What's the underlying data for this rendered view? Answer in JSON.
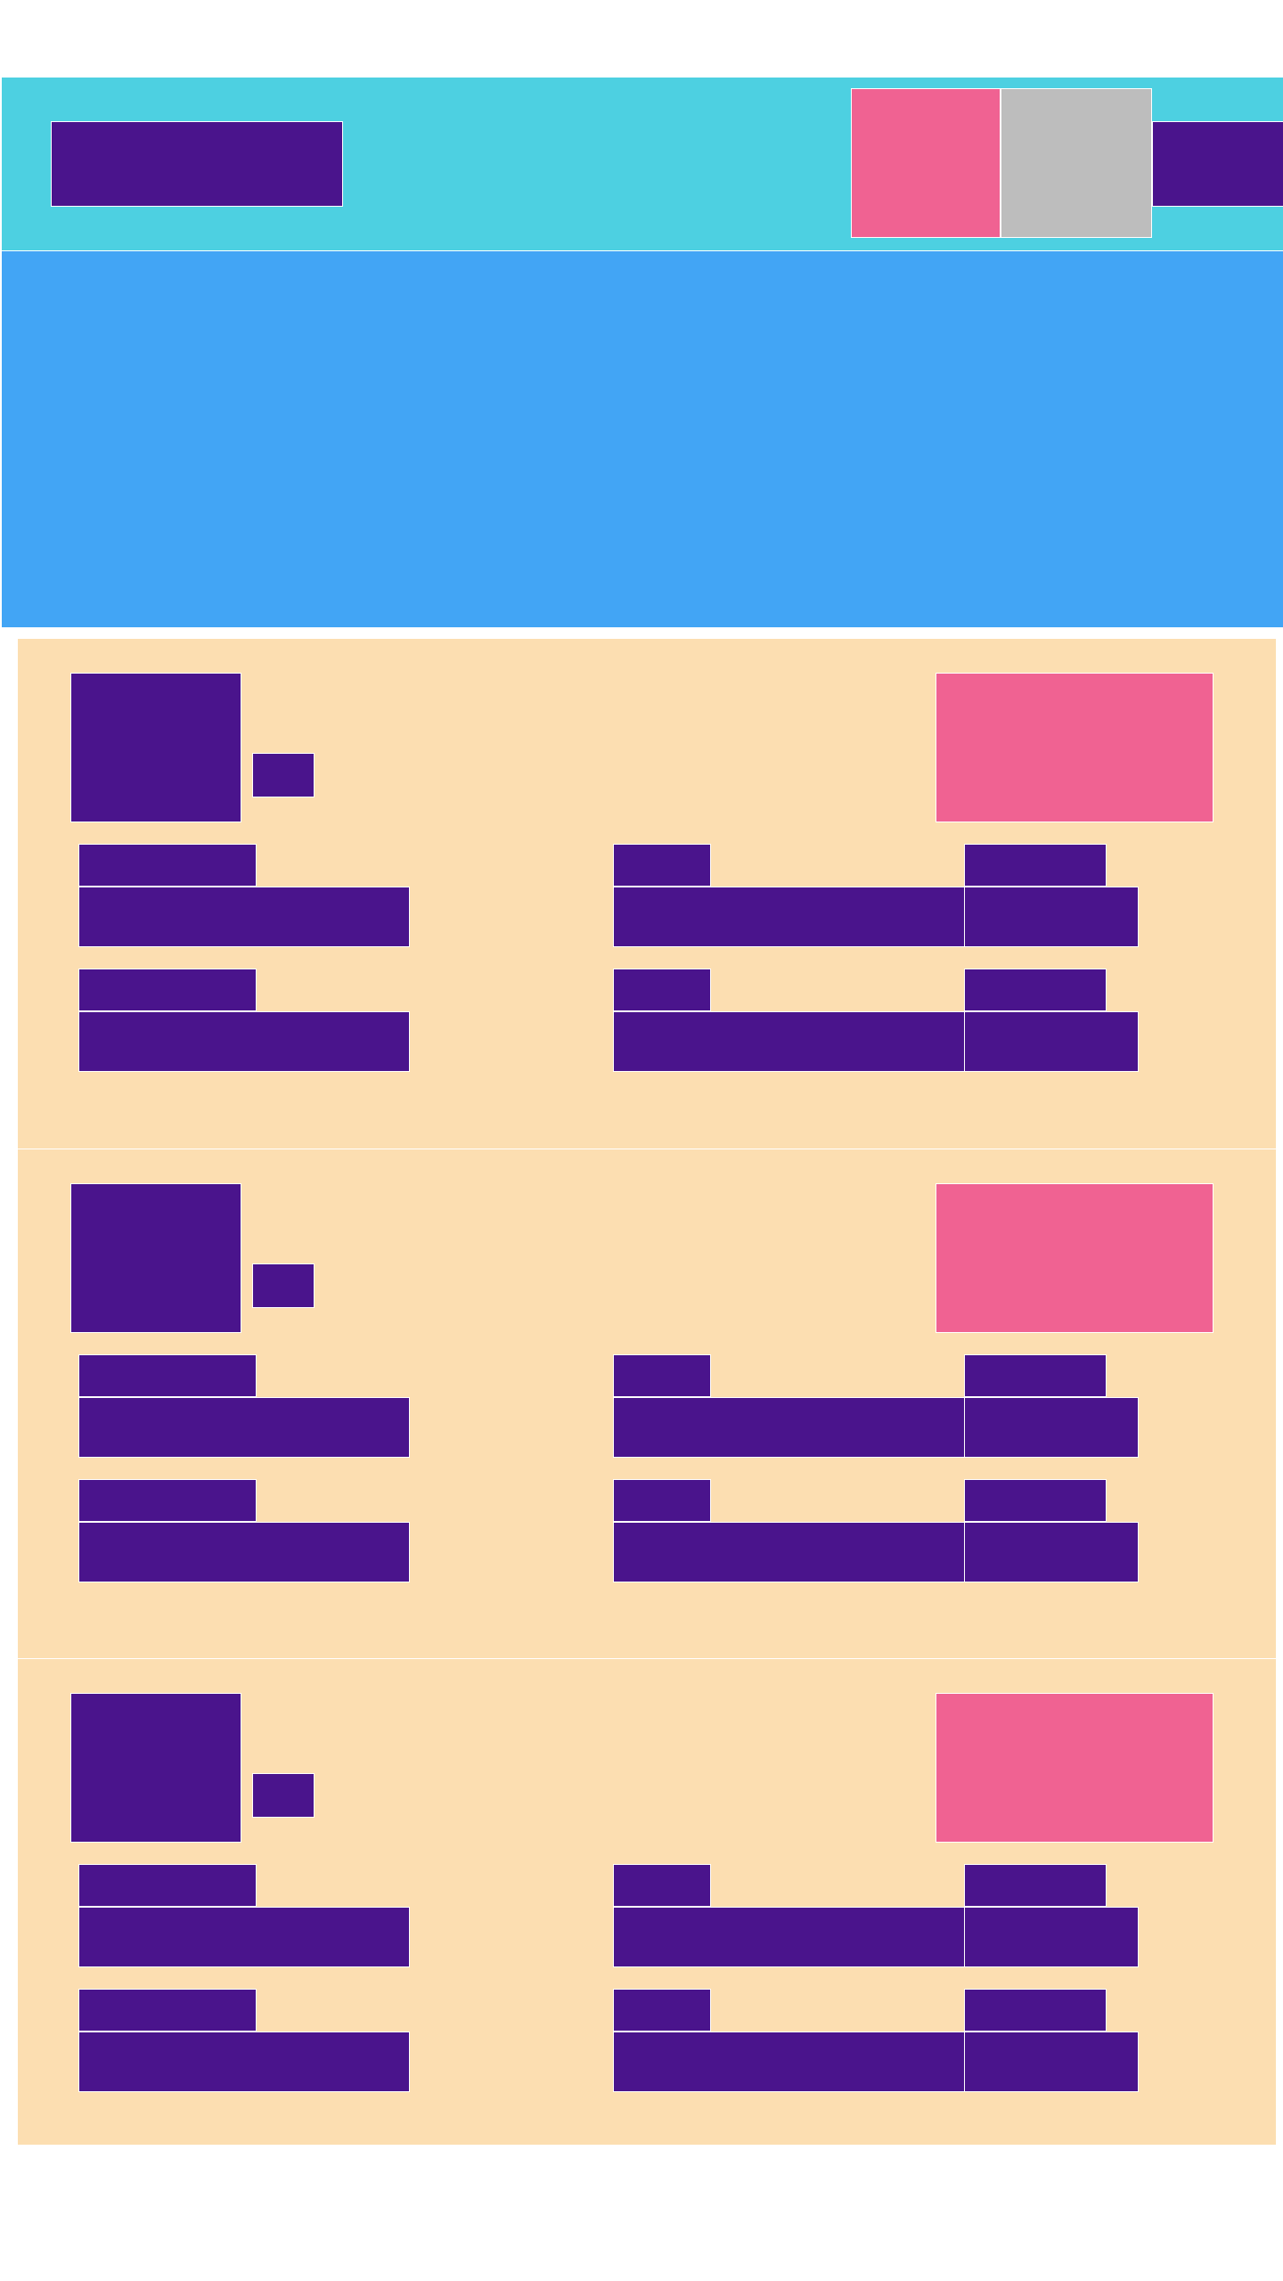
{
  "header": {
    "title": "",
    "nav": [
      "",
      "",
      ""
    ]
  },
  "hero": {
    "text": ""
  },
  "cards": [
    {
      "avatar_label": "",
      "badge": "",
      "action": "",
      "rows": [
        {
          "label_a": "",
          "value_a": "",
          "label_b": "",
          "value_b": "",
          "label_c": "",
          "value_c": ""
        },
        {
          "label_a": "",
          "value_a": "",
          "label_b": "",
          "value_b": "",
          "label_c": "",
          "value_c": ""
        }
      ]
    },
    {
      "avatar_label": "",
      "badge": "",
      "action": "",
      "rows": [
        {
          "label_a": "",
          "value_a": "",
          "label_b": "",
          "value_b": "",
          "label_c": "",
          "value_c": ""
        },
        {
          "label_a": "",
          "value_a": "",
          "label_b": "",
          "value_b": "",
          "label_c": "",
          "value_c": ""
        }
      ]
    },
    {
      "avatar_label": "",
      "badge": "",
      "action": "",
      "rows": [
        {
          "label_a": "",
          "value_a": "",
          "label_b": "",
          "value_b": "",
          "label_c": "",
          "value_c": ""
        },
        {
          "label_a": "",
          "value_a": "",
          "label_b": "",
          "value_b": "",
          "label_c": "",
          "value_c": ""
        }
      ]
    }
  ],
  "colors": {
    "header_bg": "#4dd0e1",
    "hero_bg": "#42a5f5",
    "card_bg": "#fcdeb1",
    "content_block": "#4a148c",
    "accent": "#f06292",
    "neutral": "#bdbdbd"
  }
}
